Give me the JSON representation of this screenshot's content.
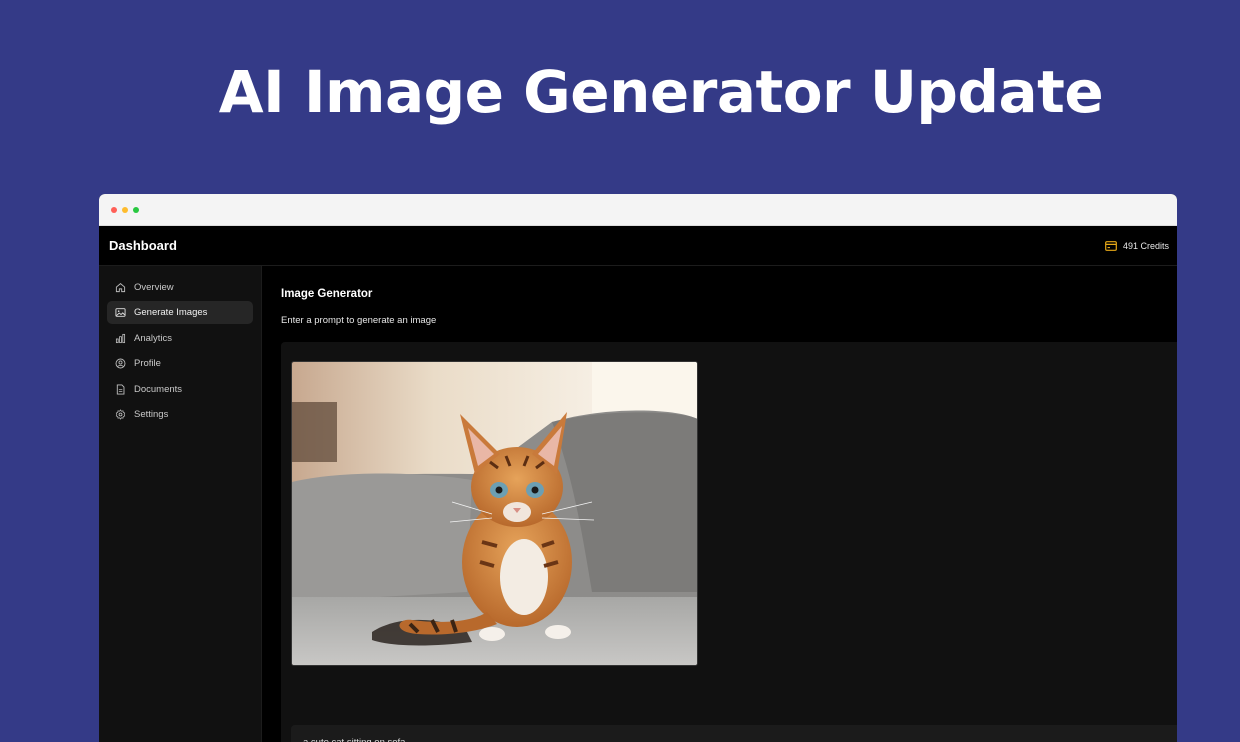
{
  "headline": "AI Image Generator Update",
  "window": {
    "app_title": "Dashboard",
    "credits": "491 Credits",
    "accent": "#e6a817"
  },
  "sidebar": {
    "items": [
      {
        "label": "Overview",
        "icon": "home-icon",
        "active": false
      },
      {
        "label": "Generate Images",
        "icon": "image-icon",
        "active": true
      },
      {
        "label": "Analytics",
        "icon": "bar-chart-icon",
        "active": false
      },
      {
        "label": "Profile",
        "icon": "user-circle-icon",
        "active": false
      },
      {
        "label": "Documents",
        "icon": "file-icon",
        "active": false
      },
      {
        "label": "Settings",
        "icon": "gear-icon",
        "active": false
      }
    ]
  },
  "main": {
    "title": "Image Generator",
    "subtitle": "Enter a prompt to generate an image",
    "prompt_value": "a cute cat sitting on sofa",
    "generated_image": "kitten-on-sofa"
  }
}
